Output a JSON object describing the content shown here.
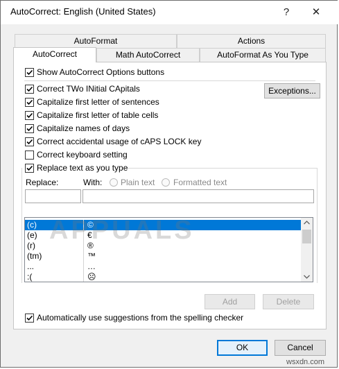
{
  "window": {
    "title": "AutoCorrect: English (United States)",
    "help_glyph": "?",
    "close_glyph": "✕"
  },
  "tabs": {
    "top": [
      "AutoFormat",
      "Actions"
    ],
    "bottom": [
      "AutoCorrect",
      "Math AutoCorrect",
      "AutoFormat As You Type"
    ],
    "active": "AutoCorrect"
  },
  "options": {
    "show_buttons": {
      "label": "Show AutoCorrect Options buttons",
      "checked": true
    },
    "two_initial": {
      "label": "Correct TWo INitial CApitals",
      "checked": true
    },
    "first_sentence": {
      "label": "Capitalize first letter of sentences",
      "checked": true
    },
    "first_table": {
      "label": "Capitalize first letter of table cells",
      "checked": true
    },
    "names_days": {
      "label": "Capitalize names of days",
      "checked": true
    },
    "caps_lock": {
      "label": "Correct accidental usage of cAPS LOCK key",
      "checked": true
    },
    "keyboard": {
      "label": "Correct keyboard setting",
      "checked": false
    },
    "replace_text": {
      "label": "Replace text as you type",
      "checked": true
    },
    "spelling": {
      "label": "Automatically use suggestions from the spelling checker",
      "checked": true
    }
  },
  "exceptions_button": "Exceptions...",
  "replace_section": {
    "replace_label": "Replace:",
    "with_label": "With:",
    "plain_text": "Plain text",
    "formatted_text": "Formatted text",
    "replace_value": "",
    "with_value": ""
  },
  "list_rows": [
    {
      "from": "(c)",
      "to": "©",
      "selected": true
    },
    {
      "from": "(e)",
      "to": "€",
      "selected": false
    },
    {
      "from": "(r)",
      "to": "®",
      "selected": false
    },
    {
      "from": "(tm)",
      "to": "™",
      "selected": false
    },
    {
      "from": "...",
      "to": "…",
      "selected": false
    },
    {
      "from": ":(",
      "to": "☹",
      "selected": false
    }
  ],
  "watermark": "APPUALS",
  "buttons": {
    "add": "Add",
    "delete": "Delete",
    "ok": "OK",
    "cancel": "Cancel"
  },
  "footer_watermark": "wsxdn.com",
  "colors": {
    "accent": "#0078d7"
  }
}
